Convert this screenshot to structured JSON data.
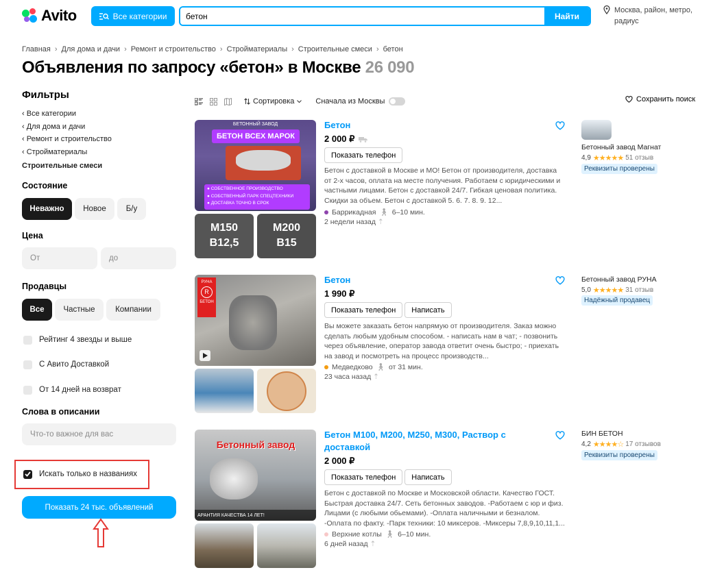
{
  "header": {
    "logo": "Avito",
    "categories_button": "Все категории",
    "search_value": "бетон",
    "search_button": "Найти",
    "location": "Москва, район, метро, радиус"
  },
  "breadcrumbs": [
    "Главная",
    "Для дома и дачи",
    "Ремонт и строительство",
    "Стройматериалы",
    "Строительные смеси",
    "бетон"
  ],
  "page": {
    "title": "Объявления по запросу «бетон» в Москве",
    "count": "26 090"
  },
  "filters": {
    "heading": "Фильтры",
    "categories": [
      "Все категории",
      "Для дома и дачи",
      "Ремонт и строительство",
      "Стройматериалы"
    ],
    "current_category": "Строительные смеси",
    "condition": {
      "heading": "Состояние",
      "options": [
        "Неважно",
        "Новое",
        "Б/у"
      ],
      "selected": "Неважно"
    },
    "price": {
      "heading": "Цена",
      "from_placeholder": "От",
      "to_placeholder": "до"
    },
    "sellers": {
      "heading": "Продавцы",
      "options": [
        "Все",
        "Частные",
        "Компании"
      ],
      "selected": "Все"
    },
    "checkboxes": [
      {
        "label": "Рейтинг 4 звезды и выше",
        "checked": false
      },
      {
        "label": "С Авито Доставкой",
        "checked": false
      },
      {
        "label": "От 14 дней на возврат",
        "checked": false
      }
    ],
    "words": {
      "heading": "Слова в описании",
      "placeholder": "Что-то важное для вас"
    },
    "title_only": {
      "label": "Искать только в названиях",
      "checked": true
    },
    "show_button": "Показать 24 тыс. объявлений"
  },
  "toolbar": {
    "sort_label": "Сортировка",
    "moscow_first": "Сначала из Москвы",
    "save_search": "Сохранить поиск"
  },
  "listings": [
    {
      "title": "Бетон",
      "price": "2 000 ₽",
      "buttons": [
        "Показать телефон"
      ],
      "description": "Бетон с доставкой в Москве и МО! Бетон от производителя, доставка от 2-х часов, оплата на месте получения. Работаем с юридическими и частными лицами. Бетон с доставкой 24/7. Гибкая ценовая политика. Скидки за объем. Бетон с доставкой 5. 6. 7. 8. 9. 12...",
      "metro": "Баррикадная",
      "metro_color": "#8e44ad",
      "walk": "6–10 мин.",
      "posted": "2 недели назад",
      "seller": "Бетонный завод Магнат",
      "rating": "4,9",
      "stars": "★★★★★",
      "reviews": "51 отзыв",
      "badge": "Реквизиты проверены",
      "photo_texts": [
        "БЕТОННЫЙ ЗАВОД",
        "БЕТОН ВСЕХ МАРОК",
        "СОБСТВЕННОЕ ПРОИЗВОДСТВО",
        "СОБСТВЕННЫЙ ПАРК СПЕЦТЕХНИКИ",
        "ДОСТАВКА ТОЧНО В СРОК",
        "М150",
        "В12,5",
        "М200",
        "В15"
      ]
    },
    {
      "title": "Бетон",
      "price": "1 990 ₽",
      "buttons": [
        "Показать телефон",
        "Написать"
      ],
      "description": "Вы можете заказать бетон напрямую от производителя. Заказ можно сделать любым удобным способом. - написать нам в чат; - позвонить через объявление, оператор завода ответит очень быстро; - приехать на завод и посмотреть на процесс производств...",
      "metro": "Медведково",
      "metro_color": "#f39c12",
      "walk": "от 31 мин.",
      "posted": "23 часа назад",
      "seller": "Бетонный завод РУНА",
      "rating": "5,0",
      "stars": "★★★★★",
      "reviews": "31 отзыв",
      "badge": "Надёжный продавец",
      "photo_texts": [
        "РУНА",
        "БЕТОН"
      ]
    },
    {
      "title": "Бетон М100, М200, М250, М300, Раствор с доставкой",
      "price": "2 000 ₽",
      "buttons": [
        "Показать телефон",
        "Написать"
      ],
      "description": "Бетон с доставкой по Москве и Московской области. Качество ГОСТ. Быстрая доставка 24/7. Сеть бетонных заводов. -Работаем с юр и физ. Лицами (с любыми обьемами). -Оплата наличными и безналом. -Оплата по факту. -Парк техники: 10 миксеров. -Миксеры 7,8,9,10,11,1...",
      "metro": "Верхние котлы",
      "metro_color": "#f8c8c8",
      "walk": "6–10 мин.",
      "posted": "6 дней назад",
      "seller": "БИН БЕТОН",
      "rating": "4,2",
      "stars": "★★★★☆",
      "reviews": "17 отзывов",
      "badge": "Реквизиты проверены",
      "photo_texts": [
        "Бетонный завод",
        "АРАНТИЯ КАЧЕСТВА 14 ЛЕТ!"
      ]
    }
  ],
  "colors": {
    "accent": "#00aaff",
    "link": "#0099f7",
    "annotation": "#e53935"
  }
}
